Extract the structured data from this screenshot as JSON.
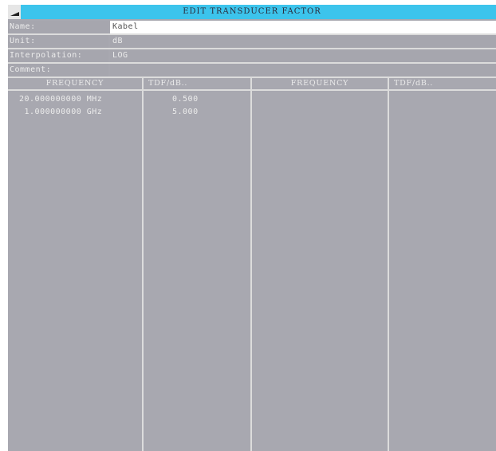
{
  "title": "EDIT TRANSDUCER FACTOR",
  "fields": {
    "name_label": "Name:",
    "name_value": "Kabel",
    "unit_label": "Unit:",
    "unit_value": "dB",
    "interpolation_label": "Interpolation:",
    "interpolation_value": "LOG",
    "comment_label": "Comment:",
    "comment_value": ""
  },
  "table": {
    "headers": [
      "FREQUENCY",
      "TDF/dB..",
      "FREQUENCY",
      "TDF/dB.."
    ],
    "rows": [
      {
        "frequency": "20.000000000 MHz",
        "tdf": "0.500"
      },
      {
        "frequency": " 1.000000000 GHz",
        "tdf": "5.000"
      }
    ]
  },
  "colors": {
    "title_bar": "#3cc4ec",
    "background": "#a8a8b0",
    "grid_line": "#dcdcdc",
    "edit_field": "#ffffff"
  }
}
